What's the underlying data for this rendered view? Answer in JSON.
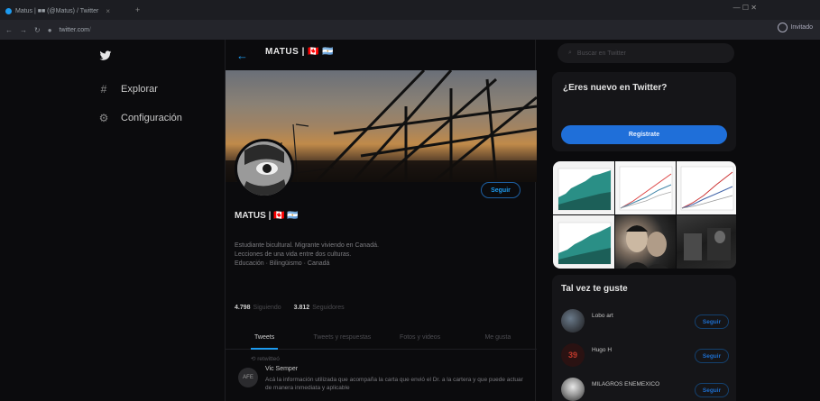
{
  "browser": {
    "tab_title": "Matus | ■■ (@Matus) / Twitter",
    "tab_close": "×",
    "new_tab": "+",
    "window_controls": "—  ☐  ✕",
    "url_domain": "twitter.com",
    "url_path": "/",
    "profile_label": "Invitado"
  },
  "nav": {
    "items": [
      {
        "label": "Explorar",
        "icon": "hash-icon"
      },
      {
        "label": "Configuración",
        "icon": "gear-icon"
      }
    ]
  },
  "profile": {
    "header_name": "MATUS | 🇨🇦 🇦🇷",
    "name": "MATUS | 🇨🇦 🇦🇷",
    "bio_lines": [
      "Estudiante bicultural. Migrante viviendo en Canadá.",
      "Lecciones de una vida entre dos culturas.",
      "Educación · Bilingüismo · Canadá"
    ],
    "stats": [
      {
        "value": "4.798",
        "label": "Siguiendo"
      },
      {
        "value": "3.812",
        "label": "Seguidores"
      }
    ],
    "follow_label": "Seguir",
    "tabs": [
      "Tweets",
      "Tweets y respuestas",
      "Fotos y videos",
      "Me gusta"
    ],
    "retweeted_text": "retwitteó",
    "tweet": {
      "avatar_text": "AFE",
      "author": "Vic Semper",
      "body": "Acá la información utilizada que acompaña la carta que envió el Dr. a la cartera y que puede actuar de manera inmediata y aplicable"
    }
  },
  "right": {
    "search_placeholder": "Buscar en Twitter",
    "signup_card": {
      "title": "¿Eres nuevo en Twitter?",
      "button": "Regístrate"
    },
    "suggestions_title": "Tal vez te guste",
    "suggestions": [
      {
        "name": "Lobo art",
        "button": "Seguir"
      },
      {
        "name": "Hugo H",
        "button": "Seguir"
      },
      {
        "name": "MILAGROS ENEMEXICO",
        "button": "Seguir"
      }
    ]
  }
}
